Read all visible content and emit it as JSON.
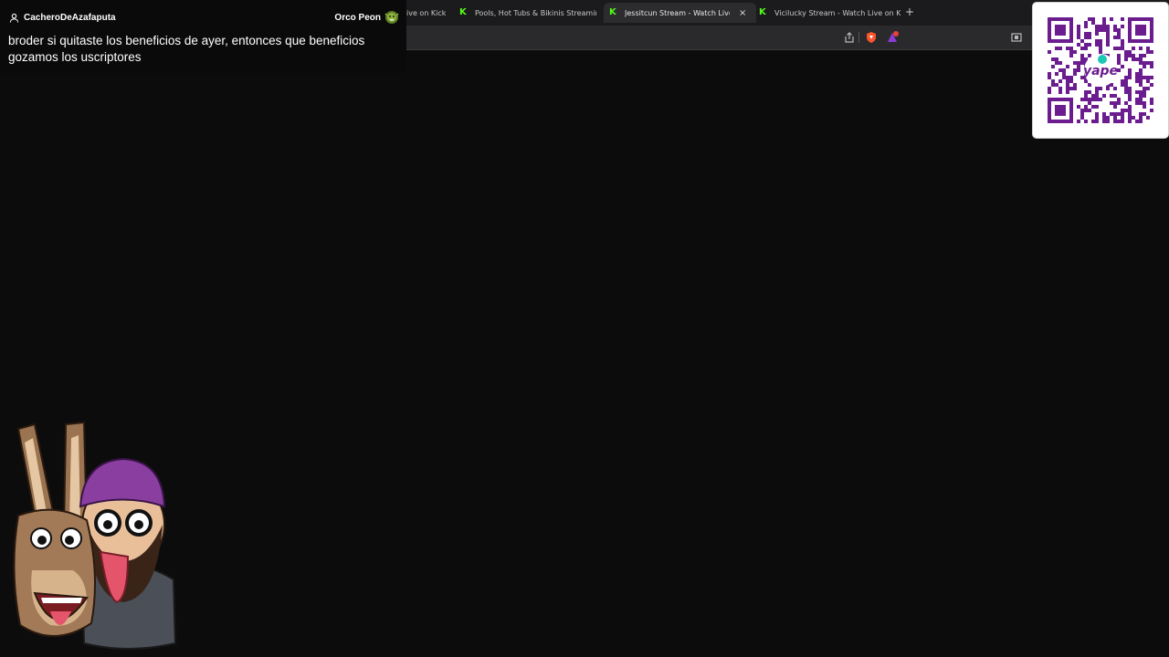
{
  "chat": {
    "username": "CacheroDeAzafaputa",
    "badge_label": "Orco Peon",
    "message": "broder si quitaste los beneficios de ayer, entonces que beneficios gozamos los uscriptores"
  },
  "browser": {
    "tabs": [
      {
        "title": "ive on Kick",
        "active": false
      },
      {
        "title": "Pools, Hot Tubs & Bikinis Streaming",
        "active": false
      },
      {
        "title": "Jessitcun Stream - Watch Live on Kick",
        "active": true
      },
      {
        "title": "Vicilucky Stream - Watch Live on Kick",
        "active": false
      }
    ],
    "new_tab_label": "+",
    "close_label": "×",
    "tab_icon": "kick-k-icon",
    "tab_icon_glyph": "K"
  },
  "qr": {
    "brand": "yape",
    "accent": "#6b1d8f"
  },
  "colors": {
    "kick_green": "#53fc18",
    "background": "#0d0c0c",
    "tab_bar": "#1b1b1d",
    "address_bar": "#2a2a2d"
  }
}
